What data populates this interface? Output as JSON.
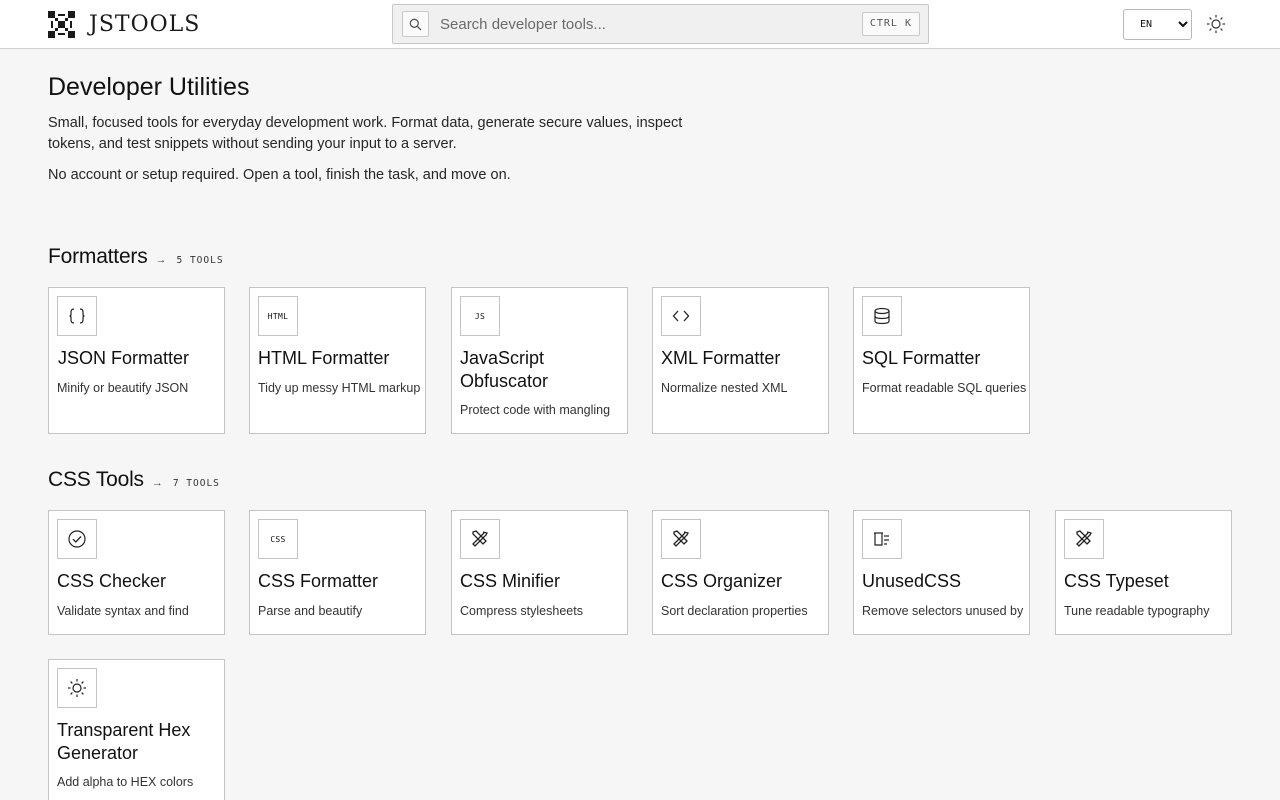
{
  "header": {
    "brand": "JSTOOLS",
    "search_placeholder": "Search developer tools...",
    "search_shortcut": "CTRL K",
    "language": "EN",
    "language_options": [
      "EN"
    ],
    "icons": {
      "logo": "logo-mark",
      "search": "search-icon",
      "theme": "sun-icon"
    }
  },
  "hero": {
    "title": "Developer Utilities",
    "description": "Small, focused tools for everyday development work. Format data, generate secure values, inspect tokens, and test snippets without sending your input to a server.",
    "note": "No account or setup required. Open a tool, finish the task, and move on."
  },
  "sections": [
    {
      "title": "Formatters",
      "arrow": "→",
      "count": "5 TOOLS",
      "tools": [
        {
          "title": "JSON Formatter",
          "desc": "Minify or beautify JSON",
          "icon": "braces-icon"
        },
        {
          "title": "HTML Formatter",
          "desc": "Tidy up messy HTML markup",
          "icon": "html-icon",
          "icon_text": "HTML"
        },
        {
          "title": "JavaScript Obfuscator",
          "desc": "Protect code with mangling",
          "icon": "js-icon",
          "icon_text": "JS"
        },
        {
          "title": "XML Formatter",
          "desc": "Normalize nested XML",
          "icon": "code-icon"
        },
        {
          "title": "SQL Formatter",
          "desc": "Format readable SQL queries",
          "icon": "database-icon"
        }
      ]
    },
    {
      "title": "CSS Tools",
      "arrow": "→",
      "count": "7 TOOLS",
      "tools": [
        {
          "title": "CSS Checker",
          "desc": "Validate syntax and find",
          "icon": "check-circle-icon"
        },
        {
          "title": "CSS Formatter",
          "desc": "Parse and beautify",
          "icon": "css-icon",
          "icon_text": "CSS"
        },
        {
          "title": "CSS Minifier",
          "desc": "Compress stylesheets",
          "icon": "tools-icon"
        },
        {
          "title": "CSS Organizer",
          "desc": "Sort declaration properties",
          "icon": "tools-icon"
        },
        {
          "title": "UnusedCSS",
          "desc": "Remove selectors unused by",
          "icon": "clear-list-icon"
        },
        {
          "title": "CSS Typeset",
          "desc": "Tune readable typography",
          "icon": "tools-icon"
        },
        {
          "title": "Transparent Hex Generator",
          "desc": "Add alpha to HEX colors",
          "icon": "sun-icon"
        }
      ]
    }
  ]
}
